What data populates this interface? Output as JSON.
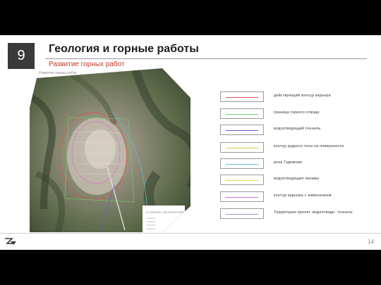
{
  "slide": {
    "section_number": "9",
    "title": "Геология и горные работы",
    "subtitle": "Развитие горных работ",
    "map_label": "Развитие горных работ",
    "map_legend_title": "УСЛОВНЫЕ ОБОЗНАЧЕНИЯ",
    "page_number": "14"
  },
  "legend": [
    {
      "label": "действующий контур карьера",
      "color": "#e05050"
    },
    {
      "label": "граница горного отвода",
      "color": "#6fcf6f"
    },
    {
      "label": "водоотводящий тоннель",
      "color": "#5b5bd6"
    },
    {
      "label": "контур рудного тела на поверхности",
      "color": "#d4c84a"
    },
    {
      "label": "река Гудемниe",
      "color": "#56c0e0"
    },
    {
      "label": "водоотводящие канавы",
      "color": "#e8d85a"
    },
    {
      "label": "контур карьера с изменением",
      "color": "#e070c8"
    },
    {
      "label": "Территория проект. водоотводн. тоннель",
      "color": "#9a9ad8"
    }
  ],
  "colors": {
    "accent": "#c0392b",
    "number_box": "#3a3a3a"
  }
}
